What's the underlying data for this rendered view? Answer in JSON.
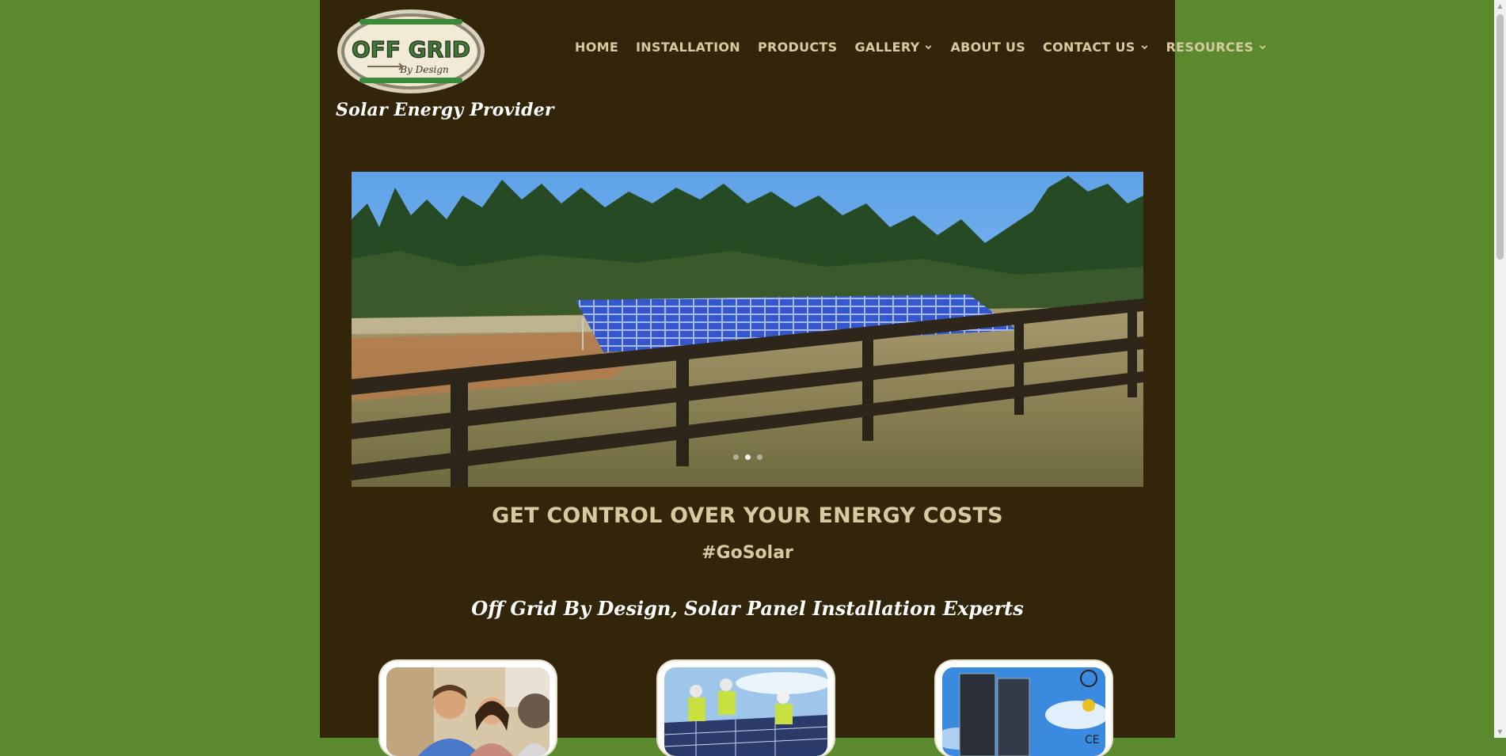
{
  "brand": {
    "logo_text_main": "OFF GRID",
    "logo_text_sub": "By Design",
    "tagline": "Solar Energy Provider"
  },
  "nav": {
    "items": [
      {
        "label": "HOME",
        "dropdown": false
      },
      {
        "label": "INSTALLATION",
        "dropdown": false
      },
      {
        "label": "PRODUCTS",
        "dropdown": false
      },
      {
        "label": "GALLERY",
        "dropdown": true
      },
      {
        "label": "ABOUT US",
        "dropdown": false
      },
      {
        "label": "CONTACT US",
        "dropdown": true
      },
      {
        "label": "RESOURCES",
        "dropdown": true
      }
    ]
  },
  "hero": {
    "icon": "solar-array-photo",
    "slides": 3,
    "active_slide": 2
  },
  "main": {
    "headline": "GET CONTROL OVER YOUR ENERGY COSTS",
    "hashtag": "#GoSolar",
    "subheading": "Off Grid By Design, Solar Panel Installation Experts"
  },
  "cards": [
    {
      "icon": "consultation-photo"
    },
    {
      "icon": "installers-photo"
    },
    {
      "icon": "solar-panel-product-photo"
    }
  ],
  "colors": {
    "outer_bg": "#5b8a2e",
    "page_bg": "#33250a",
    "nav_text": "#d8c9a0",
    "heading_text": "#d8c9a0",
    "script_text": "#ffffff"
  }
}
